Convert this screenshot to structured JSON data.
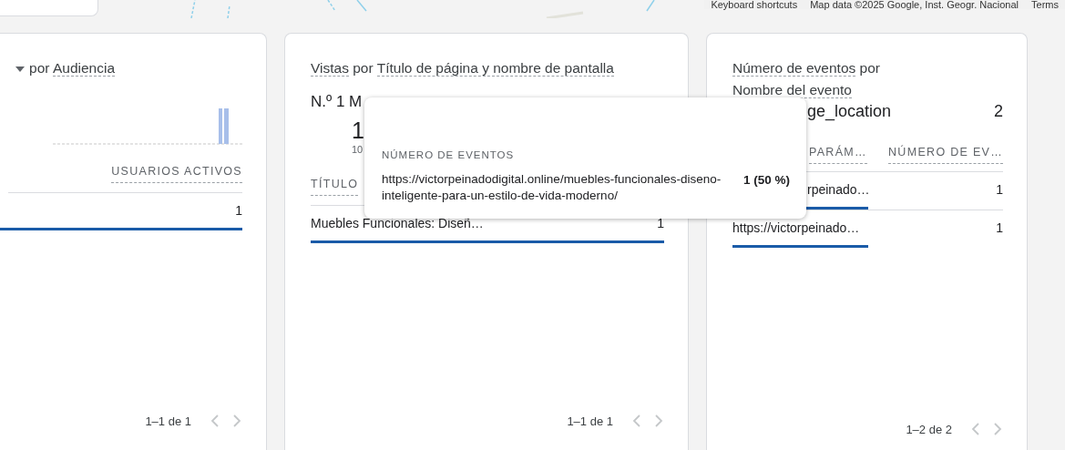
{
  "map": {
    "attribution": [
      "Keyboard shortcuts",
      "Map data ©2025 Google, Inst. Geogr. Nacional",
      "Terms"
    ]
  },
  "cards": [
    {
      "kind": "audience",
      "title": [
        {
          "text": "por",
          "link": false
        },
        {
          "text": "Audiencia",
          "link": true
        }
      ],
      "columns": [
        "USUARIOS ACTIVOS"
      ],
      "rows": [
        {
          "value": "1"
        }
      ],
      "pagination": "1–1 de 1"
    },
    {
      "kind": "top_item",
      "title": [
        {
          "text": "Vistas",
          "link": true
        },
        {
          "text": "por",
          "link": false
        },
        {
          "text": "Título de página y nombre de pantalla",
          "link": true
        }
      ],
      "rank": "N.º 1 M",
      "big_value": "1",
      "sub_value": "10",
      "columns": [
        "TÍTULO"
      ],
      "rows": [
        {
          "label": "Muebles Funcionales: Diseñ…",
          "value": "1"
        }
      ],
      "pagination": "1–1 de 1"
    },
    {
      "kind": "event_table",
      "title": [
        {
          "text": "Número de eventos",
          "link": true
        },
        {
          "text": "por",
          "link": false
        },
        {
          "text": "Nombre del evento",
          "link": true
        }
      ],
      "rank": "ge_location",
      "rank_value": "2",
      "columns": [
        "PARÁM…",
        "NÚMERO DE EV…"
      ],
      "rows": [
        {
          "label": "rpeinado…",
          "value": "1"
        },
        {
          "label": "https://victorpeinado…",
          "value": "1"
        }
      ],
      "pagination": "1–2 de 2"
    }
  ],
  "tooltip": {
    "heading": "NÚMERO DE EVENTOS",
    "label": "https://victorpeinadodigital.online/muebles-funcionales-diseno-inteligente-para-un-estilo-de-vida-moderno/",
    "value": "1 (50 %)"
  }
}
